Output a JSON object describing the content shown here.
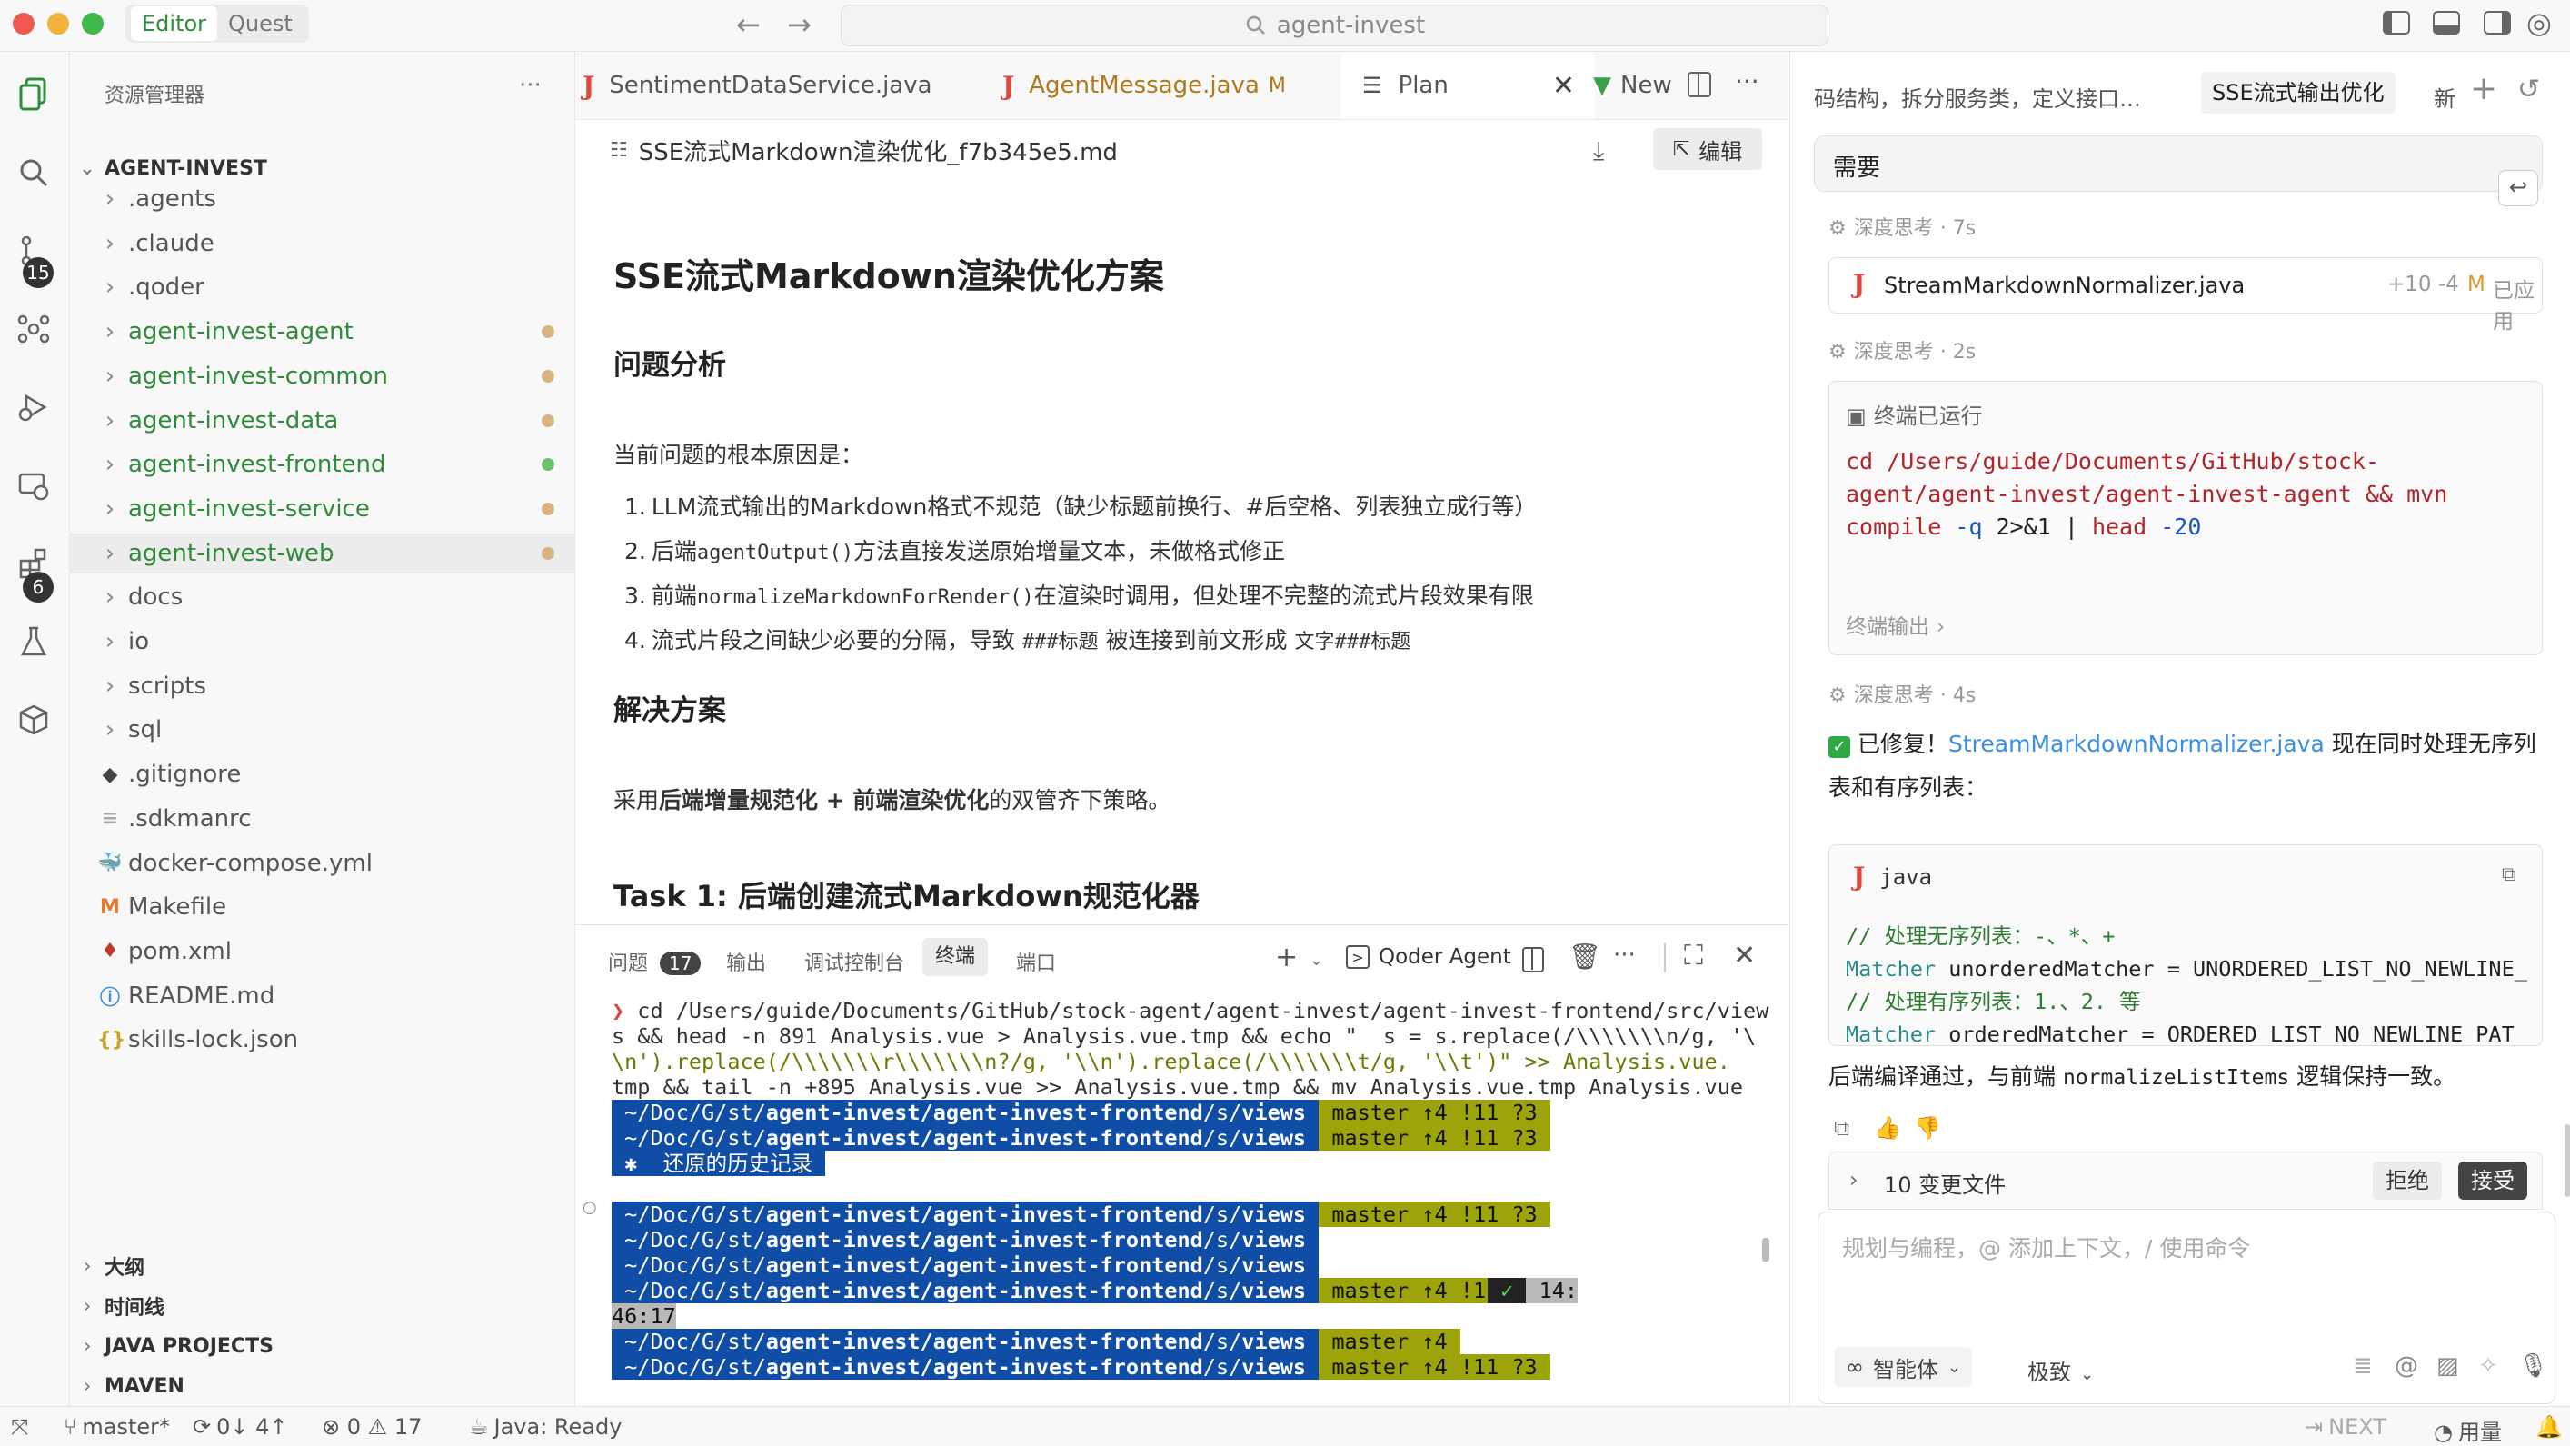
{
  "titlebar": {
    "modes": [
      "Editor",
      "Quest"
    ],
    "search": "agent-invest"
  },
  "activity": {
    "scm_badge": "15",
    "ext_badge": "6"
  },
  "explorer": {
    "header": "资源管理器",
    "root": "AGENT-INVEST",
    "items": [
      {
        "label": ".agents"
      },
      {
        "label": ".claude"
      },
      {
        "label": ".qoder"
      },
      {
        "label": "agent-invest-agent"
      },
      {
        "label": "agent-invest-common"
      },
      {
        "label": "agent-invest-data"
      },
      {
        "label": "agent-invest-frontend"
      },
      {
        "label": "agent-invest-service"
      },
      {
        "label": "agent-invest-web"
      },
      {
        "label": "docs"
      },
      {
        "label": "io"
      },
      {
        "label": "scripts"
      },
      {
        "label": "sql"
      },
      {
        "label": ".gitignore"
      },
      {
        "label": ".sdkmanrc"
      },
      {
        "label": "docker-compose.yml"
      },
      {
        "label": "Makefile"
      },
      {
        "label": "pom.xml"
      },
      {
        "label": "README.md"
      },
      {
        "label": "skills-lock.json"
      }
    ],
    "sections": [
      "大纲",
      "时间线",
      "JAVA PROJECTS",
      "MAVEN"
    ]
  },
  "editor": {
    "tabs": [
      {
        "label": "SentimentDataService.java"
      },
      {
        "label": "AgentMessage.java",
        "suffix": "M"
      },
      {
        "label": "Plan"
      },
      {
        "label": "New"
      }
    ],
    "file_title": "SSE流式Markdown渲染优化_f7b345e5.md",
    "edit_label": "编辑",
    "doc": {
      "h1": "SSE流式Markdown渲染优化方案",
      "h2_problem": "问题分析",
      "intro": "当前问题的根本原因是：",
      "list": [
        {
          "n": "1.",
          "a": "LLM流式输出的Markdown格式不规范（缺少标题前换行、#后空格、列表独立成行等）",
          "code": "",
          "b": ""
        },
        {
          "n": "2.",
          "a": "后端",
          "code": "agentOutput()",
          "b": "方法直接发送原始增量文本，未做格式修正"
        },
        {
          "n": "3.",
          "a": "前端",
          "code": "normalizeMarkdownForRender()",
          "b": "在渲染时调用，但处理不完整的流式片段效果有限"
        },
        {
          "n": "4.",
          "a": "流式片段之间缺少必要的分隔，导致 ",
          "code": "###标题",
          "b": " 被连接到前文形成 ",
          "code2": "文字###标题"
        }
      ],
      "h2_solution": "解决方案",
      "sol_a": "采用",
      "sol_b": "后端增量规范化 + 前端渲染优化",
      "sol_c": "的双管齐下策略。",
      "h2_task": "Task 1: 后端创建流式Markdown规范化器"
    }
  },
  "panel": {
    "tabs": [
      "问题",
      "输出",
      "调试控制台",
      "终端",
      "端口"
    ],
    "problem_count": "17",
    "agent_label": "Qoder Agent",
    "cmd1": " cd /Users/guide/Documents/GitHub/stock-agent/agent-invest/agent-invest-frontend/src/view",
    "cmd2": "s && head -n 891 Analysis.vue > Analysis.vue.tmp && echo \"  s = s.replace(/\\\\\\\\\\\\\\n/g, '\\",
    "cmd3": "\\n').replace(/\\\\\\\\\\\\\\r\\\\\\\\\\\\\\n?/g, '\\\\n').replace(/\\\\\\\\\\\\\\t/g, '\\\\t')\" >> Analysis.vue.",
    "cmd4": "tmp && tail -n +895 Analysis.vue >> Analysis.vue.tmp && mv Analysis.vue.tmp Analysis.vue",
    "path_a": " ~/Doc/G/st/",
    "path_b": "agent-invest/agent-invest-frontend",
    "path_c": "/s/",
    "path_d": "views ",
    "git": " master ↑4 !11 ?3 ",
    "git_short": " master ↑4 ",
    "history": " ✱  还原的历史记录 ",
    "check": " ✓ ",
    "time_a": " 14:",
    "time_b": "46:17"
  },
  "chat": {
    "tabs": [
      "码结构，拆分服务类，定义接口…",
      "SSE流式输出优化",
      "新"
    ],
    "need": "需要",
    "think1": "深度思考 · 7s",
    "file_card": {
      "name": "StreamMarkdownNormalizer.java",
      "diff": "+10 -4",
      "m": "M",
      "status": "已应用"
    },
    "think2": "深度思考 · 2s",
    "terminal_title": "终端已运行",
    "term_cmd1": "cd /Users/guide/Documents/GitHub/stock-",
    "term_cmd2": "agent/agent-invest/agent-invest-agent && mvn",
    "term_cmd3a": "compile ",
    "term_cmd3b": "-q",
    "term_cmd3c": " 2>&1 | ",
    "term_cmd3d": "head",
    "term_cmd3e": " -20",
    "term_output": "终端输出",
    "think3": "深度思考 · 4s",
    "fixed_a": "已修复！",
    "fixed_link": "StreamMarkdownNormalizer.java",
    "fixed_b": " 现在同时处理无序列",
    "fixed_c": "表和有序列表：",
    "code_lang": "java",
    "code1": "// 处理无序列表：-、*、+",
    "code2a": "Matcher",
    "code2b": " unorderedMatcher = UNORDERED_LIST_NO_NEWLINE_",
    "code3": "// 处理有序列表：1.、2. 等",
    "code4a": "Matcher",
    "code4b": " orderedMatcher = ORDERED_LIST_NO_NEWLINE_PAT",
    "summary_a": "后端编译通过，与前端 ",
    "summary_code": "normalizeListItems",
    "summary_b": " 逻辑保持一致。",
    "changes": "10 变更文件",
    "reject": "拒绝",
    "accept": "接受",
    "input_placeholder": "规划与编程，@ 添加上下文，/ 使用命令",
    "mode": "智能体",
    "model": "极致"
  },
  "status": {
    "branch": "master*",
    "sync": "0↓ 4↑",
    "errors": "0",
    "warnings": "17",
    "java": "Java: Ready",
    "next": "NEXT",
    "usage": "用量"
  },
  "colors": {
    "green_folder": "#2e8b3a",
    "accent": "#2c8e3c",
    "term_blue": "#0f4da6",
    "term_git": "#9da40a"
  }
}
